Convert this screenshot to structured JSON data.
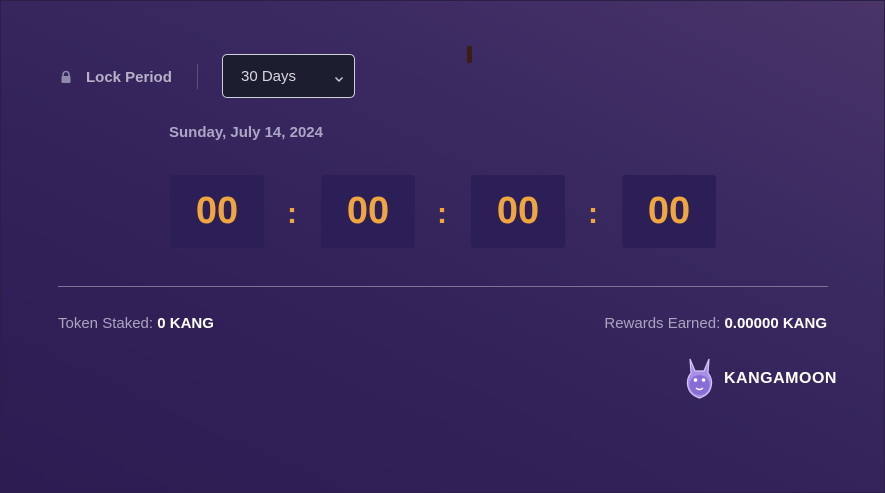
{
  "lock_period": {
    "label": "Lock Period",
    "icon": "lock-icon"
  },
  "select": {
    "value": "30 Days"
  },
  "date": "Sunday, July 14, 2024",
  "countdown": [
    "00",
    "00",
    "00",
    "00"
  ],
  "countdown_separator": ":",
  "stats": {
    "staked_label": "Token Staked:",
    "staked_value": "0 KANG",
    "rewards_label": "Rewards Earned:",
    "rewards_value": "0.00000 KANG"
  },
  "logo": {
    "text": "KANGAMOON"
  },
  "colors": {
    "accent": "#f0a640",
    "box_bg": "#2c1f57",
    "background": "#33225a"
  }
}
